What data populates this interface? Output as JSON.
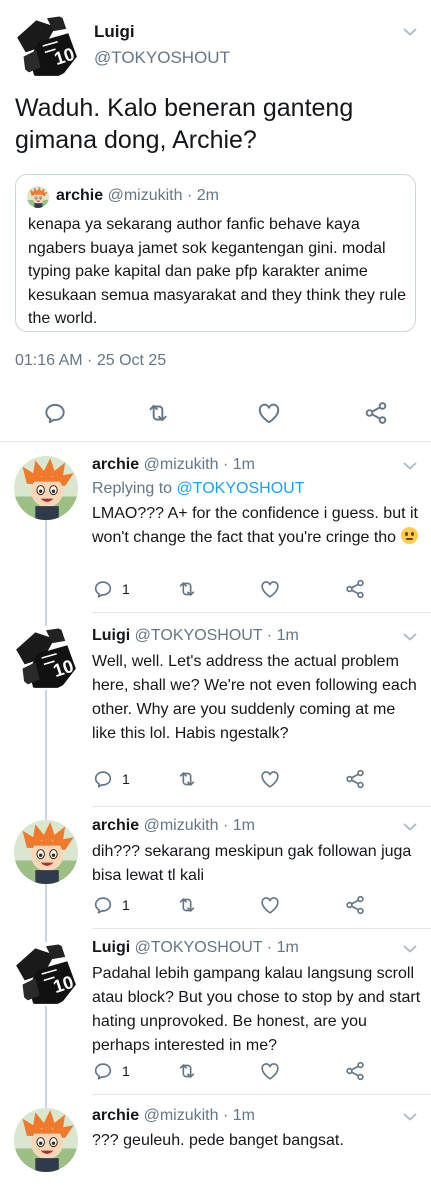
{
  "main": {
    "name": "Luigi",
    "handle": "@TOKYOSHOUT",
    "text": "Waduh. Kalo beneran ganteng gimana dong, Archie?",
    "quote": {
      "name": "archie",
      "meta": "@mizukith · 2m",
      "text": "kenapa ya sekarang author fanfic behave kaya ngabers buaya jamet sok kegantengan gini. modal typing pake kapital dan pake pfp karakter anime kesukaan semua masyarakat and they think they rule the world."
    },
    "timestamp": "01:16 AM · 25 Oct 25"
  },
  "replies": [
    {
      "name": "archie",
      "meta": "@mizukith · 1m",
      "replying_prefix": "Replying to",
      "replying_to": "@TOKYOSHOUT",
      "text": "LMAO??? A+ for the confidence i guess. but it won't change the fact that you're cringe tho",
      "reply_count": "1"
    },
    {
      "name": "Luigi",
      "meta": "@TOKYOSHOUT · 1m",
      "text": "Well, well. Let's address the actual problem here, shall we? We're not even following each other. Why are you suddenly coming at me like this lol. Habis ngestalk?",
      "reply_count": "1"
    },
    {
      "name": "archie",
      "meta": "@mizukith · 1m",
      "text": "dih??? sekarang meskipun gak followan juga bisa lewat tl kali",
      "reply_count": "1"
    },
    {
      "name": "Luigi",
      "meta": "@TOKYOSHOUT · 1m",
      "text": "Padahal lebih gampang kalau langsung scroll atau block? But you chose to stop by and start hating unprovoked. Be honest, are you perhaps interested in me?",
      "reply_count": "1"
    },
    {
      "name": "archie",
      "meta": "@mizukith · 1m",
      "text": "??? geuleuh. pede banget bangsat."
    }
  ],
  "colors": {
    "text": "#14171a",
    "muted": "#657786",
    "link": "#1da1f2",
    "border": "#e1e8ed",
    "icon": "#657786"
  },
  "icons": [
    "chevron-down-icon",
    "reply-icon",
    "retweet-icon",
    "like-icon",
    "share-icon",
    "grimacing-emoji"
  ]
}
